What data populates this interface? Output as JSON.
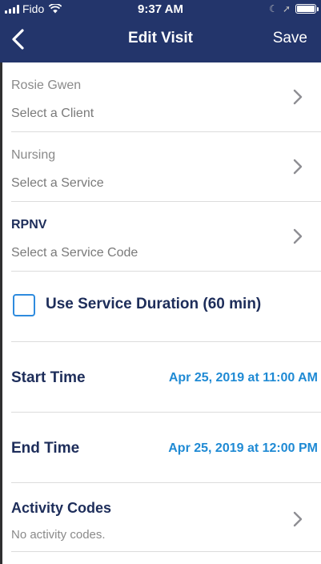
{
  "status_bar": {
    "carrier": "Fido",
    "time": "9:37 AM"
  },
  "nav": {
    "title": "Edit Visit",
    "save_label": "Save"
  },
  "rows": {
    "client": {
      "value": "Rosie Gwen",
      "hint": "Select a Client"
    },
    "service": {
      "value": "Nursing",
      "hint": "Select a Service"
    },
    "service_code": {
      "value": "RPNV",
      "hint": "Select a Service Code"
    }
  },
  "duration": {
    "label": "Use Service Duration (60 min)",
    "checked": false
  },
  "start_time": {
    "label": "Start Time",
    "value": "Apr 25, 2019 at 11:00 AM"
  },
  "end_time": {
    "label": "End Time",
    "value": "Apr 25, 2019 at 12:00 PM"
  },
  "activity": {
    "label": "Activity Codes",
    "value": "No activity codes."
  },
  "colors": {
    "nav_bg": "#23356b",
    "accent": "#1f8ad4",
    "checkbox": "#2e8bde",
    "label_text": "#1d2d5a"
  },
  "icons": [
    "back-chevron-icon",
    "chevron-right-icon",
    "wifi-icon",
    "signal-icon",
    "battery-icon",
    "moon-icon",
    "location-icon"
  ]
}
